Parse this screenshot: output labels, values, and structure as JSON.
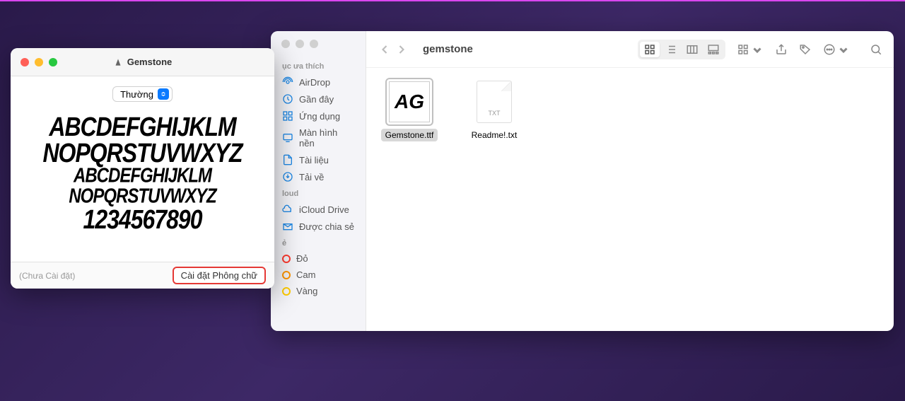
{
  "fontbook": {
    "title": "Gemstone",
    "style_selected": "Thường",
    "preview_lines": [
      "ABCDEFGHIJKLM",
      "NOPQRSTUVWXYZ",
      "ABCDEFGHIJKLM",
      "NOPQRSTUVWXYZ",
      "1234567890"
    ],
    "status": "(Chưa Cài đặt)",
    "install_button": "Cài đặt Phông chữ"
  },
  "finder": {
    "title": "gemstone",
    "sidebar": {
      "section_favorites": "ục ưa thích",
      "items_fav": [
        "AirDrop",
        "Gần đây",
        "Ứng dụng",
        "Màn hình nền",
        "Tài liệu",
        "Tải về"
      ],
      "section_icloud": "loud",
      "items_icloud": [
        "iCloud Drive",
        "Được chia sẻ"
      ],
      "section_tags": "ẻ",
      "tags": [
        "Đỏ",
        "Cam",
        "Vàng"
      ]
    },
    "files": [
      {
        "name": "Gemstone.ttf",
        "icon_text": "AG",
        "selected": true
      },
      {
        "name": "Readme!.txt",
        "icon_label": "TXT",
        "selected": false
      }
    ]
  }
}
